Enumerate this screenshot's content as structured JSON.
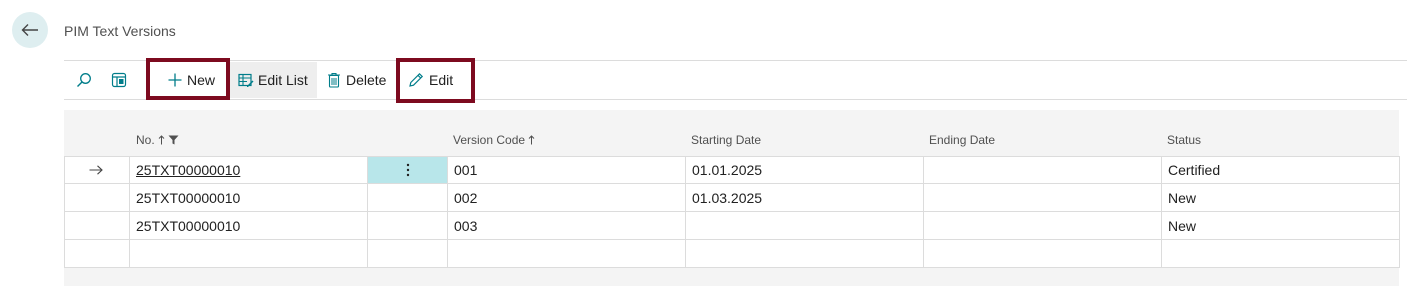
{
  "page": {
    "title": "PIM Text Versions"
  },
  "toolbar": {
    "new_label": "New",
    "edit_list_label": "Edit List",
    "delete_label": "Delete",
    "edit_label": "Edit"
  },
  "table": {
    "columns": {
      "no": "No.",
      "version_code": "Version Code",
      "starting_date": "Starting Date",
      "ending_date": "Ending Date",
      "status": "Status"
    },
    "rows": [
      {
        "no": "25TXT00000010",
        "version_code": "001",
        "starting_date": "01.01.2025",
        "ending_date": "",
        "status": "Certified",
        "current": true
      },
      {
        "no": "25TXT00000010",
        "version_code": "002",
        "starting_date": "01.03.2025",
        "ending_date": "",
        "status": "New"
      },
      {
        "no": "25TXT00000010",
        "version_code": "003",
        "starting_date": "",
        "ending_date": "",
        "status": "New"
      }
    ]
  },
  "colors": {
    "accent": "#007d8a",
    "highlight": "#7d0a1f",
    "selected_cell": "#b8e6ea"
  },
  "icons": [
    "back-arrow-icon",
    "search-icon",
    "layout-icon",
    "plus-icon",
    "edit-list-icon",
    "trash-icon",
    "pencil-icon",
    "sort-ascending-icon",
    "filter-icon",
    "current-row-arrow-icon",
    "more-options-icon"
  ]
}
